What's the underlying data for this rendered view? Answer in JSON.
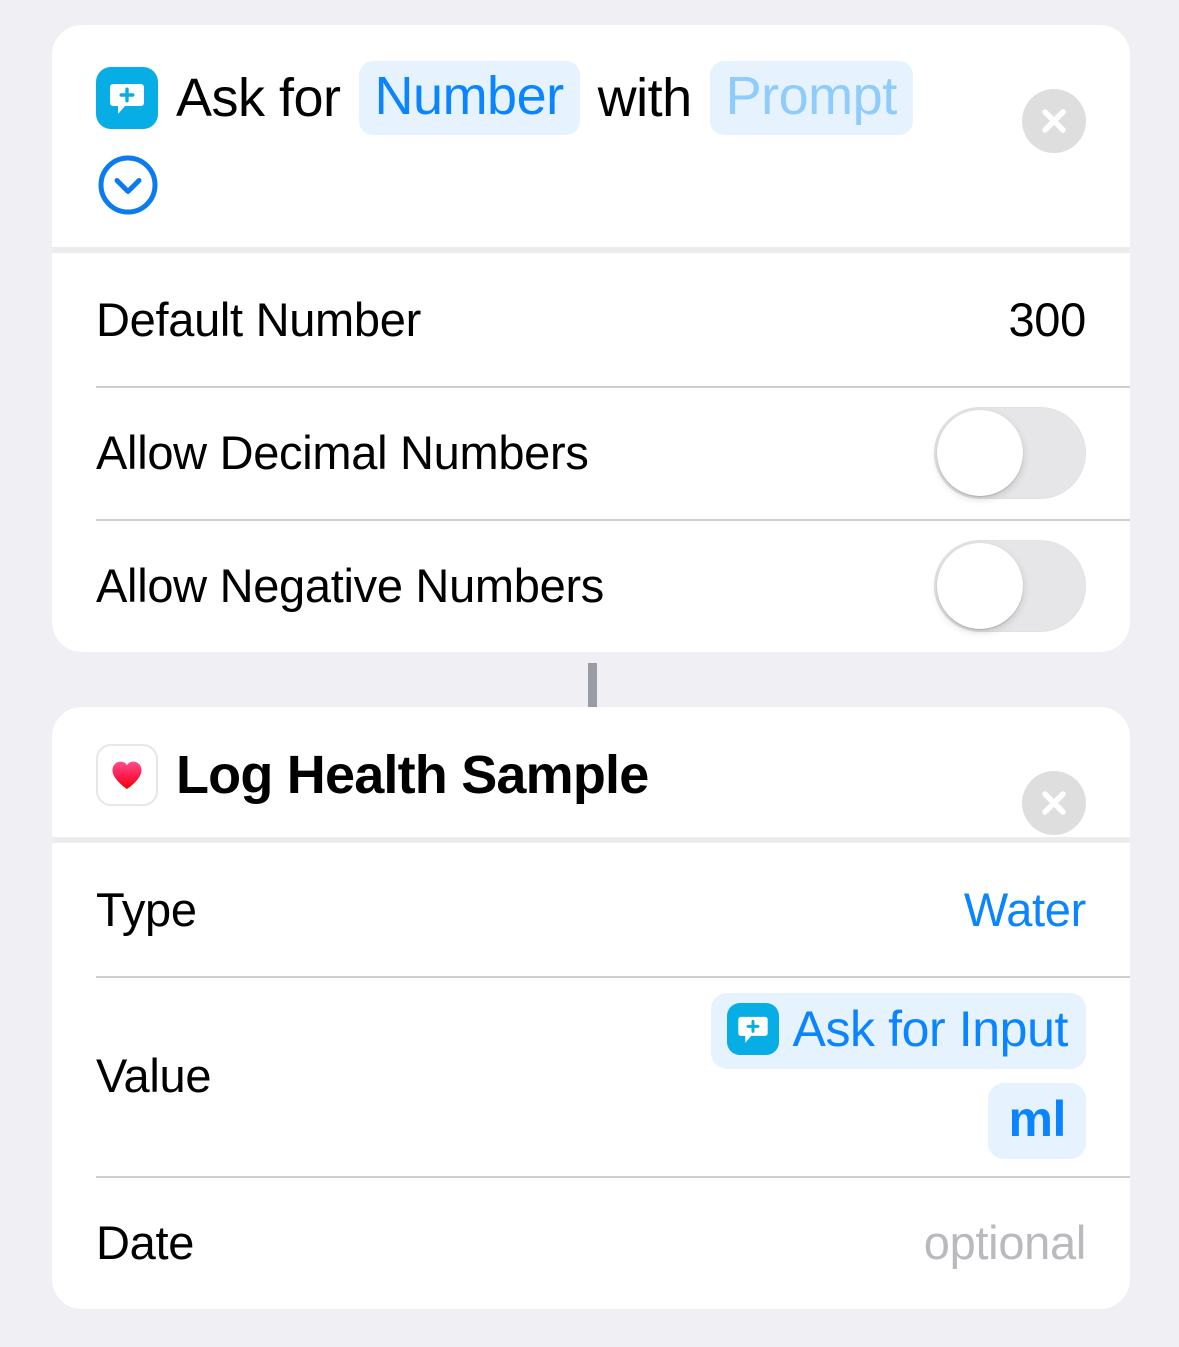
{
  "theme": {
    "background": "#F0EFF4",
    "card_background": "#FFFFFF",
    "accent_blue": "#0A84FF",
    "token_pill_background": "#E6F2FE",
    "placeholder_blue": "#8FCBFB",
    "ask_icon_background": "#06AEE5",
    "muted_text": "#B9B9BE",
    "connector": "#9A9CA5",
    "toggle_off_track": "#E6E6E8"
  },
  "actions": [
    {
      "id": "ask-for-input",
      "icon_name": "ask-for-input-icon",
      "header": {
        "text_before": "Ask for",
        "type_token": "Number",
        "text_middle": "with",
        "prompt_placeholder": "Prompt",
        "disclosure_icon": "chevron-down-circle-icon",
        "close_icon": "close-icon"
      },
      "rows": [
        {
          "label": "Default Number",
          "value": "300",
          "kind": "text",
          "style": "plain"
        },
        {
          "label": "Allow Decimal Numbers",
          "kind": "toggle",
          "toggle_on": false
        },
        {
          "label": "Allow Negative Numbers",
          "kind": "toggle",
          "toggle_on": false
        }
      ]
    },
    {
      "id": "log-health-sample",
      "icon_name": "health-heart-icon",
      "header": {
        "title": "Log Health Sample",
        "close_icon": "close-icon"
      },
      "rows": [
        {
          "label": "Type",
          "value": "Water",
          "kind": "text",
          "style": "blue"
        },
        {
          "label": "Value",
          "kind": "tokens",
          "variable_token": {
            "icon_name": "ask-for-input-icon",
            "label": "Ask for Input"
          },
          "unit_token": "ml"
        },
        {
          "label": "Date",
          "value": "optional",
          "kind": "text",
          "style": "muted"
        }
      ]
    }
  ]
}
